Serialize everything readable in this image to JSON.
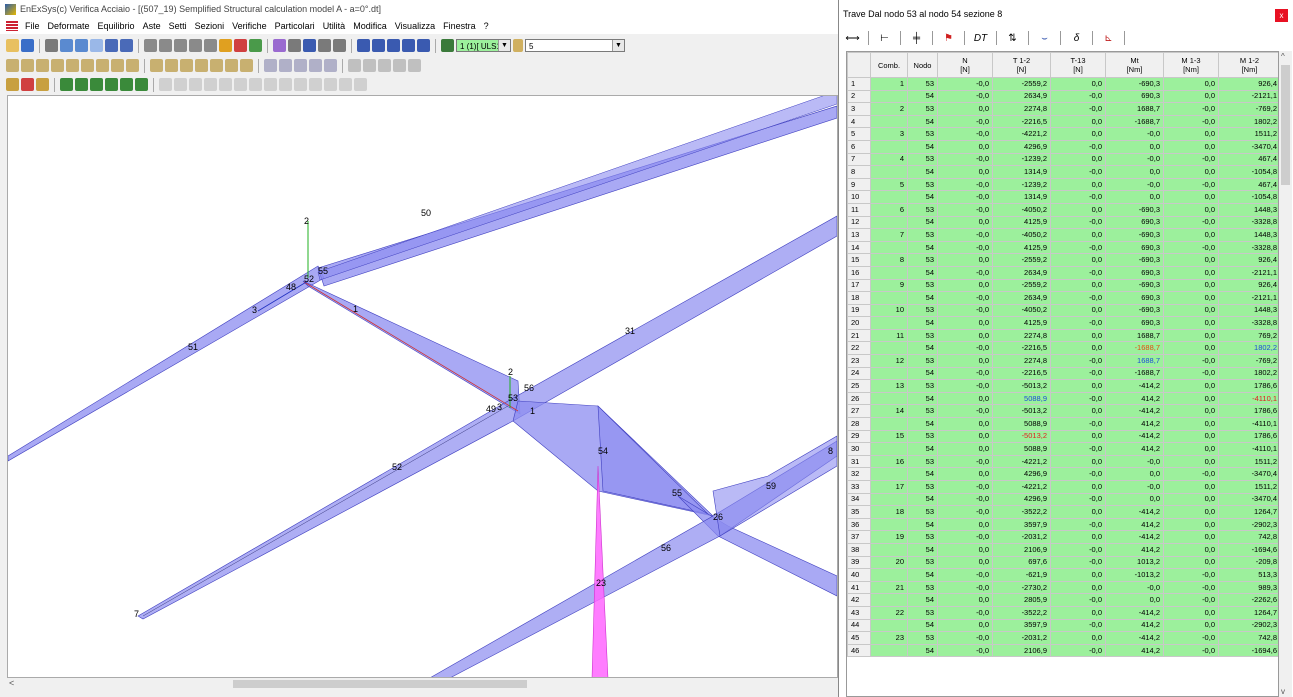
{
  "window": {
    "title": "EnExSys(c) Verifica Acciaio - [(507_19) Semplified Structural calculation model A - a=0°.dt]"
  },
  "menu": [
    "File",
    "Deformate",
    "Equilibrio",
    "Aste",
    "Setti",
    "Sezioni",
    "Verifiche",
    "Particolari",
    "Utilità",
    "Modifica",
    "Visualizza",
    "Finestra",
    "?"
  ],
  "toolbar": {
    "load_combo": "1 (1)[ ULS1 - wind+",
    "step_value": "5"
  },
  "viewport": {
    "labels": [
      "2",
      "50",
      "52",
      "48",
      "55",
      "3",
      "1",
      "51",
      "2",
      "53",
      "49",
      "3",
      "56",
      "1",
      "31",
      "52",
      "54",
      "55",
      "59",
      "26",
      "56",
      "23",
      "7",
      "8"
    ]
  },
  "panel": {
    "title": "Trave Dal nodo 53 al nodo 54  sezione 8",
    "close": "x",
    "toolbar_labels": {
      "dt": "DT",
      "delta": "δ"
    },
    "columns": [
      {
        "name": "",
        "unit": ""
      },
      {
        "name": "Comb.",
        "unit": ""
      },
      {
        "name": "Nodo",
        "unit": ""
      },
      {
        "name": "N",
        "unit": "[N]"
      },
      {
        "name": "T 1-2",
        "unit": "[N]"
      },
      {
        "name": "T-13",
        "unit": "[N]"
      },
      {
        "name": "Mt",
        "unit": "[Nm]"
      },
      {
        "name": "M 1-3",
        "unit": "[Nm]"
      },
      {
        "name": "M 1-2",
        "unit": "[Nm]"
      }
    ],
    "rows": [
      [
        "1",
        "1",
        "53",
        "-0,0",
        "-2559,2",
        "0,0",
        "-690,3",
        "0,0",
        "926,4"
      ],
      [
        "2",
        "",
        "54",
        "-0,0",
        "2634,9",
        "-0,0",
        "690,3",
        "0,0",
        "-2121,1"
      ],
      [
        "3",
        "2",
        "53",
        "0,0",
        "2274,8",
        "-0,0",
        "1688,7",
        "-0,0",
        "-769,2"
      ],
      [
        "4",
        "",
        "54",
        "-0,0",
        "-2216,5",
        "0,0",
        "-1688,7",
        "-0,0",
        "1802,2"
      ],
      [
        "5",
        "3",
        "53",
        "-0,0",
        "-4221,2",
        "0,0",
        "-0,0",
        "0,0",
        "1511,2"
      ],
      [
        "6",
        "",
        "54",
        "0,0",
        "4296,9",
        "-0,0",
        "0,0",
        "0,0",
        "-3470,4"
      ],
      [
        "7",
        "4",
        "53",
        "-0,0",
        "-1239,2",
        "0,0",
        "-0,0",
        "-0,0",
        "467,4"
      ],
      [
        "8",
        "",
        "54",
        "0,0",
        "1314,9",
        "-0,0",
        "0,0",
        "0,0",
        "-1054,8"
      ],
      [
        "9",
        "5",
        "53",
        "-0,0",
        "-1239,2",
        "0,0",
        "-0,0",
        "-0,0",
        "467,4"
      ],
      [
        "10",
        "",
        "54",
        "-0,0",
        "1314,9",
        "-0,0",
        "0,0",
        "0,0",
        "-1054,8"
      ],
      [
        "11",
        "6",
        "53",
        "-0,0",
        "-4050,2",
        "0,0",
        "-690,3",
        "0,0",
        "1448,3"
      ],
      [
        "12",
        "",
        "54",
        "0,0",
        "4125,9",
        "-0,0",
        "690,3",
        "-0,0",
        "-3328,8"
      ],
      [
        "13",
        "7",
        "53",
        "-0,0",
        "-4050,2",
        "0,0",
        "-690,3",
        "0,0",
        "1448,3"
      ],
      [
        "14",
        "",
        "54",
        "-0,0",
        "4125,9",
        "-0,0",
        "690,3",
        "-0,0",
        "-3328,8"
      ],
      [
        "15",
        "8",
        "53",
        "0,0",
        "-2559,2",
        "0,0",
        "-690,3",
        "0,0",
        "926,4"
      ],
      [
        "16",
        "",
        "54",
        "-0,0",
        "2634,9",
        "-0,0",
        "690,3",
        "0,0",
        "-2121,1"
      ],
      [
        "17",
        "9",
        "53",
        "0,0",
        "-2559,2",
        "0,0",
        "-690,3",
        "0,0",
        "926,4"
      ],
      [
        "18",
        "",
        "54",
        "-0,0",
        "2634,9",
        "-0,0",
        "690,3",
        "0,0",
        "-2121,1"
      ],
      [
        "19",
        "10",
        "53",
        "-0,0",
        "-4050,2",
        "0,0",
        "-690,3",
        "0,0",
        "1448,3"
      ],
      [
        "20",
        "",
        "54",
        "0,0",
        "4125,9",
        "-0,0",
        "690,3",
        "0,0",
        "-3328,8"
      ],
      [
        "21",
        "11",
        "53",
        "0,0",
        "2274,8",
        "0,0",
        "1688,7",
        "0,0",
        "769,2"
      ],
      [
        "22",
        "",
        "54",
        "-0,0",
        "-2216,5",
        "0,0",
        "-1688,7",
        "0,0",
        "1802,2"
      ],
      [
        "23",
        "12",
        "53",
        "0,0",
        "2274,8",
        "-0,0",
        "1688,7",
        "-0,0",
        "-769,2"
      ],
      [
        "24",
        "",
        "54",
        "-0,0",
        "-2216,5",
        "-0,0",
        "-1688,7",
        "-0,0",
        "1802,2"
      ],
      [
        "25",
        "13",
        "53",
        "-0,0",
        "-5013,2",
        "0,0",
        "-414,2",
        "0,0",
        "1786,6"
      ],
      [
        "26",
        "",
        "54",
        "0,0",
        "5088,9",
        "-0,0",
        "414,2",
        "0,0",
        "-4110,1"
      ],
      [
        "27",
        "14",
        "53",
        "-0,0",
        "-5013,2",
        "0,0",
        "-414,2",
        "0,0",
        "1786,6"
      ],
      [
        "28",
        "",
        "54",
        "0,0",
        "5088,9",
        "-0,0",
        "414,2",
        "0,0",
        "-4110,1"
      ],
      [
        "29",
        "15",
        "53",
        "0,0",
        "-5013,2",
        "0,0",
        "-414,2",
        "0,0",
        "1786,6"
      ],
      [
        "30",
        "",
        "54",
        "0,0",
        "5088,9",
        "-0,0",
        "414,2",
        "0,0",
        "-4110,1"
      ],
      [
        "31",
        "16",
        "53",
        "-0,0",
        "-4221,2",
        "0,0",
        "-0,0",
        "0,0",
        "1511,2"
      ],
      [
        "32",
        "",
        "54",
        "0,0",
        "4296,9",
        "-0,0",
        "0,0",
        "-0,0",
        "-3470,4"
      ],
      [
        "33",
        "17",
        "53",
        "-0,0",
        "-4221,2",
        "0,0",
        "-0,0",
        "0,0",
        "1511,2"
      ],
      [
        "34",
        "",
        "54",
        "-0,0",
        "4296,9",
        "-0,0",
        "0,0",
        "0,0",
        "-3470,4"
      ],
      [
        "35",
        "18",
        "53",
        "-0,0",
        "-3522,2",
        "0,0",
        "-414,2",
        "0,0",
        "1264,7"
      ],
      [
        "36",
        "",
        "54",
        "0,0",
        "3597,9",
        "-0,0",
        "414,2",
        "0,0",
        "-2902,3"
      ],
      [
        "37",
        "19",
        "53",
        "-0,0",
        "-2031,2",
        "0,0",
        "-414,2",
        "0,0",
        "742,8"
      ],
      [
        "38",
        "",
        "54",
        "0,0",
        "2106,9",
        "-0,0",
        "414,2",
        "0,0",
        "-1694,6"
      ],
      [
        "39",
        "20",
        "53",
        "0,0",
        "697,6",
        "-0,0",
        "1013,2",
        "0,0",
        "-209,8"
      ],
      [
        "40",
        "",
        "54",
        "-0,0",
        "-621,9",
        "0,0",
        "-1013,2",
        "-0,0",
        "513,3"
      ],
      [
        "41",
        "21",
        "53",
        "-0,0",
        "-2730,2",
        "0,0",
        "-0,0",
        "-0,0",
        "989,3"
      ],
      [
        "42",
        "",
        "54",
        "0,0",
        "2805,9",
        "-0,0",
        "0,0",
        "-0,0",
        "-2262,6"
      ],
      [
        "43",
        "22",
        "53",
        "-0,0",
        "-3522,2",
        "0,0",
        "-414,2",
        "0,0",
        "1264,7"
      ],
      [
        "44",
        "",
        "54",
        "0,0",
        "3597,9",
        "-0,0",
        "414,2",
        "0,0",
        "-2902,3"
      ],
      [
        "45",
        "23",
        "53",
        "-0,0",
        "-2031,2",
        "0,0",
        "-414,2",
        "-0,0",
        "742,8"
      ],
      [
        "46",
        "",
        "54",
        "-0,0",
        "2106,9",
        "-0,0",
        "414,2",
        "-0,0",
        "-1694,6"
      ]
    ],
    "highlights": [
      {
        "row": 22,
        "col": 6,
        "color": "#e05010"
      },
      {
        "row": 22,
        "col": 8,
        "color": "#1a4fd6"
      },
      {
        "row": 23,
        "col": 6,
        "color": "#1a4fd6"
      },
      {
        "row": 26,
        "col": 4,
        "color": "#1a4fd6"
      },
      {
        "row": 26,
        "col": 8,
        "color": "#e02020"
      },
      {
        "row": 29,
        "col": 4,
        "color": "#e02020"
      }
    ]
  },
  "colors": {
    "member_fill": "#8c8cf0",
    "member_stroke": "#4040c0",
    "column_fill": "#ff66ff",
    "grid_green": "#9cf09c"
  }
}
